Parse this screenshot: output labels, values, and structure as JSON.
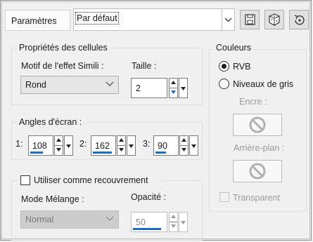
{
  "preset": {
    "label": "Paramètres",
    "value": "Par défaut"
  },
  "toolbar": {
    "save_icon": "floppy-disk-icon",
    "load_icon": "dice-cube-icon",
    "reset_icon": "reset-undo-icon"
  },
  "cells": {
    "group_label": "Propriétés des cellules",
    "pattern_label": "Motif de l'effet Simili :",
    "pattern_value": "Rond",
    "size_label": "Taille :",
    "size_value": "2"
  },
  "angles": {
    "group_label": "Angles d'écran :",
    "items": [
      {
        "label": "1:",
        "value": "108",
        "fill": 0.6
      },
      {
        "label": "2:",
        "value": "162",
        "fill": 0.9
      },
      {
        "label": "3:",
        "value": "90",
        "fill": 0.5
      }
    ]
  },
  "overlay": {
    "checkbox_label": "Utiliser comme recouvrement",
    "blend_label": "Mode Mélange :",
    "blend_value": "Normal",
    "opacity_label": "Opacité :",
    "opacity_value": "50"
  },
  "colors": {
    "group_label": "Couleurs",
    "rgb_label": "RVB",
    "gray_label": "Niveaux de gris",
    "ink_label": "Encre :",
    "background_label": "Arrière-plan :",
    "transparent_label": "Transparent"
  }
}
